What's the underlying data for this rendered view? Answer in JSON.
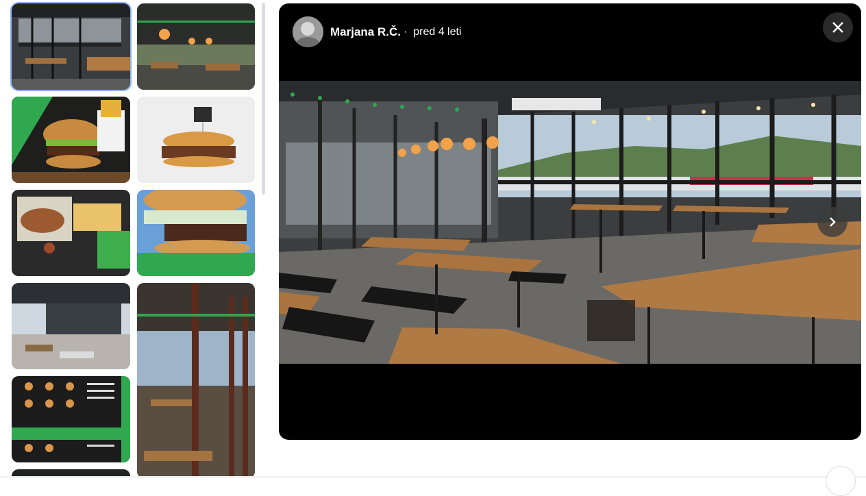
{
  "viewer": {
    "author": "Marjana R.Č.",
    "separator": "·",
    "time": "pred 4 leti",
    "close_icon": "close-icon",
    "next_icon": "chevron-right-icon"
  },
  "thumbnails": [
    {
      "id": "thumb-1",
      "subject": "restaurant-interior",
      "selected": true
    },
    {
      "id": "thumb-2",
      "subject": "restaurant-lamps"
    },
    {
      "id": "thumb-3",
      "subject": "burger-ad"
    },
    {
      "id": "thumb-4",
      "subject": "burger-white"
    },
    {
      "id": "thumb-5",
      "subject": "burger-tray"
    },
    {
      "id": "thumb-6",
      "subject": "burger-closeup"
    },
    {
      "id": "thumb-7",
      "subject": "terrace"
    },
    {
      "id": "thumb-8",
      "subject": "interior-tall"
    },
    {
      "id": "thumb-9",
      "subject": "menu"
    },
    {
      "id": "thumb-10",
      "subject": "partial"
    }
  ],
  "colors": {
    "accent": "#8ab4f8",
    "brand_green": "#2fa84f"
  }
}
